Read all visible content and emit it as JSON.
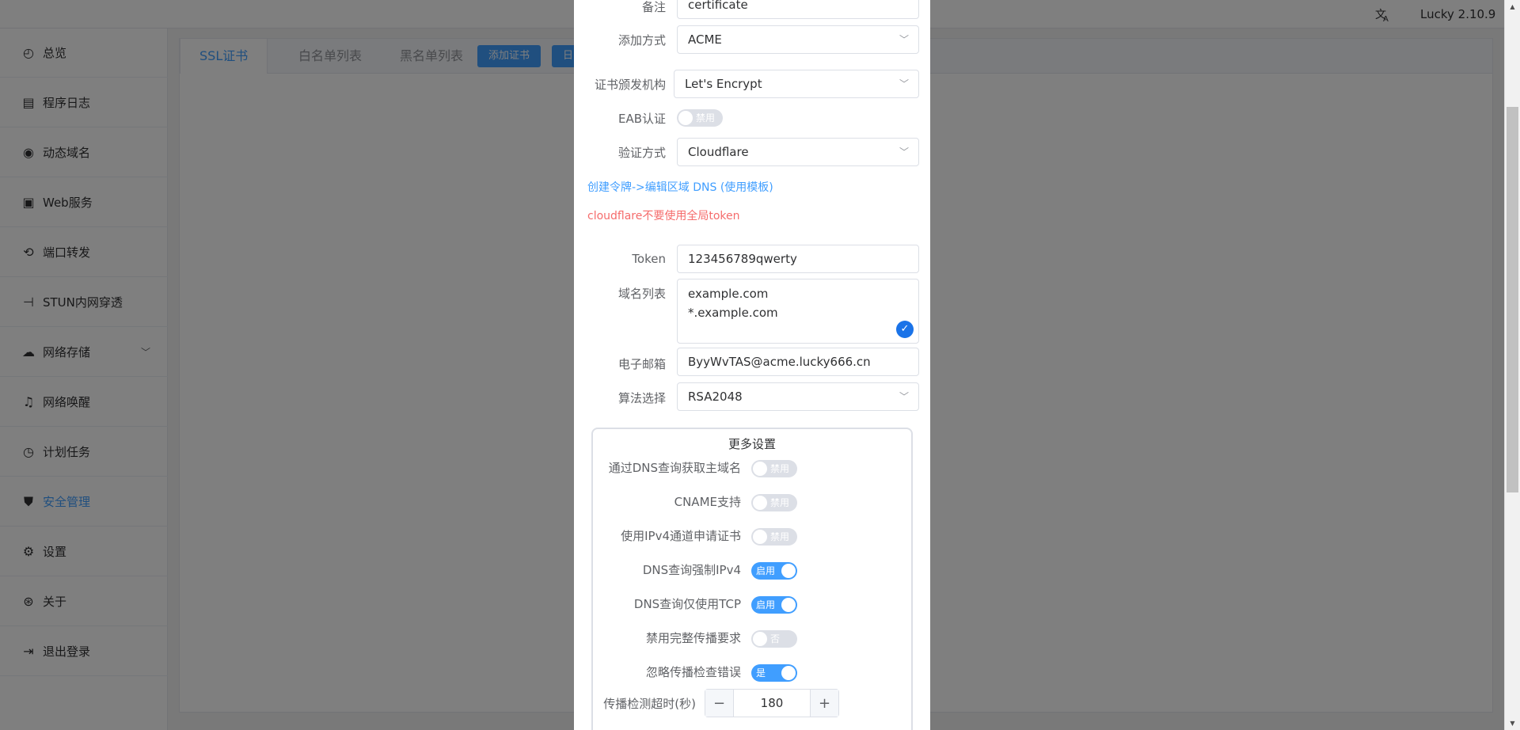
{
  "topbar": {
    "translate_icon": "translate-icon",
    "version": "Lucky 2.10.9"
  },
  "sidebar": {
    "items": [
      {
        "label": "总览",
        "icon": "dashboard-icon"
      },
      {
        "label": "程序日志",
        "icon": "log-icon"
      },
      {
        "label": "动态域名",
        "icon": "dns-icon"
      },
      {
        "label": "Web服务",
        "icon": "web-icon"
      },
      {
        "label": "端口转发",
        "icon": "port-forward-icon"
      },
      {
        "label": "STUN内网穿透",
        "icon": "stun-icon"
      },
      {
        "label": "网络存储",
        "icon": "cloud-upload-icon"
      },
      {
        "label": "网络唤醒",
        "icon": "bell-icon"
      },
      {
        "label": "计划任务",
        "icon": "clock-icon"
      },
      {
        "label": "安全管理",
        "icon": "shield-icon"
      },
      {
        "label": "设置",
        "icon": "gear-icon"
      },
      {
        "label": "关于",
        "icon": "about-icon"
      },
      {
        "label": "退出登录",
        "icon": "logout-icon"
      }
    ]
  },
  "tabs": [
    "SSL证书",
    "白名单列表",
    "黑名单列表"
  ],
  "toolbar": {
    "add_cert": "添加证书",
    "partial_btn": "日"
  },
  "form": {
    "remark_label": "备注",
    "remark_value": "certificate",
    "add_method_label": "添加方式",
    "add_method_value": "ACME",
    "ca_label": "证书颁发机构",
    "ca_value": "Let's Encrypt",
    "eab_label": "EAB认证",
    "eab_state": "禁用",
    "verify_label": "验证方式",
    "verify_value": "Cloudflare",
    "create_token_link": "创建令牌->编辑区域 DNS (使用模板)",
    "token_warning": "cloudflare不要使用全局token",
    "token_label": "Token",
    "token_value": "123456789qwerty",
    "domains_label": "域名列表",
    "domains": [
      "example.com",
      "*.example.com"
    ],
    "email_label": "电子邮箱",
    "email_value": "ByyWvTAS@acme.lucky666.cn",
    "algo_label": "算法选择",
    "algo_value": "RSA2048"
  },
  "more": {
    "title": "更多设置",
    "items": [
      {
        "label": "通过DNS查询获取主域名",
        "state": "禁用",
        "on": false
      },
      {
        "label": "CNAME支持",
        "state": "禁用",
        "on": false
      },
      {
        "label": "使用IPv4通道申请证书",
        "state": "禁用",
        "on": false
      },
      {
        "label": "DNS查询强制IPv4",
        "state": "启用",
        "on": true
      },
      {
        "label": "DNS查询仅使用TCP",
        "state": "启用",
        "on": true
      },
      {
        "label": "禁用完整传播要求",
        "state": "否",
        "on": false
      },
      {
        "label": "忽略传播检查错误",
        "state": "是",
        "on": true
      }
    ],
    "timeout_label": "传播检测超时(秒)",
    "timeout_value": "180",
    "minus": "−",
    "plus": "+"
  },
  "colors": {
    "primary": "#409eff",
    "danger": "#f56c6c",
    "overlay": "rgba(0,0,0,0.5)"
  }
}
